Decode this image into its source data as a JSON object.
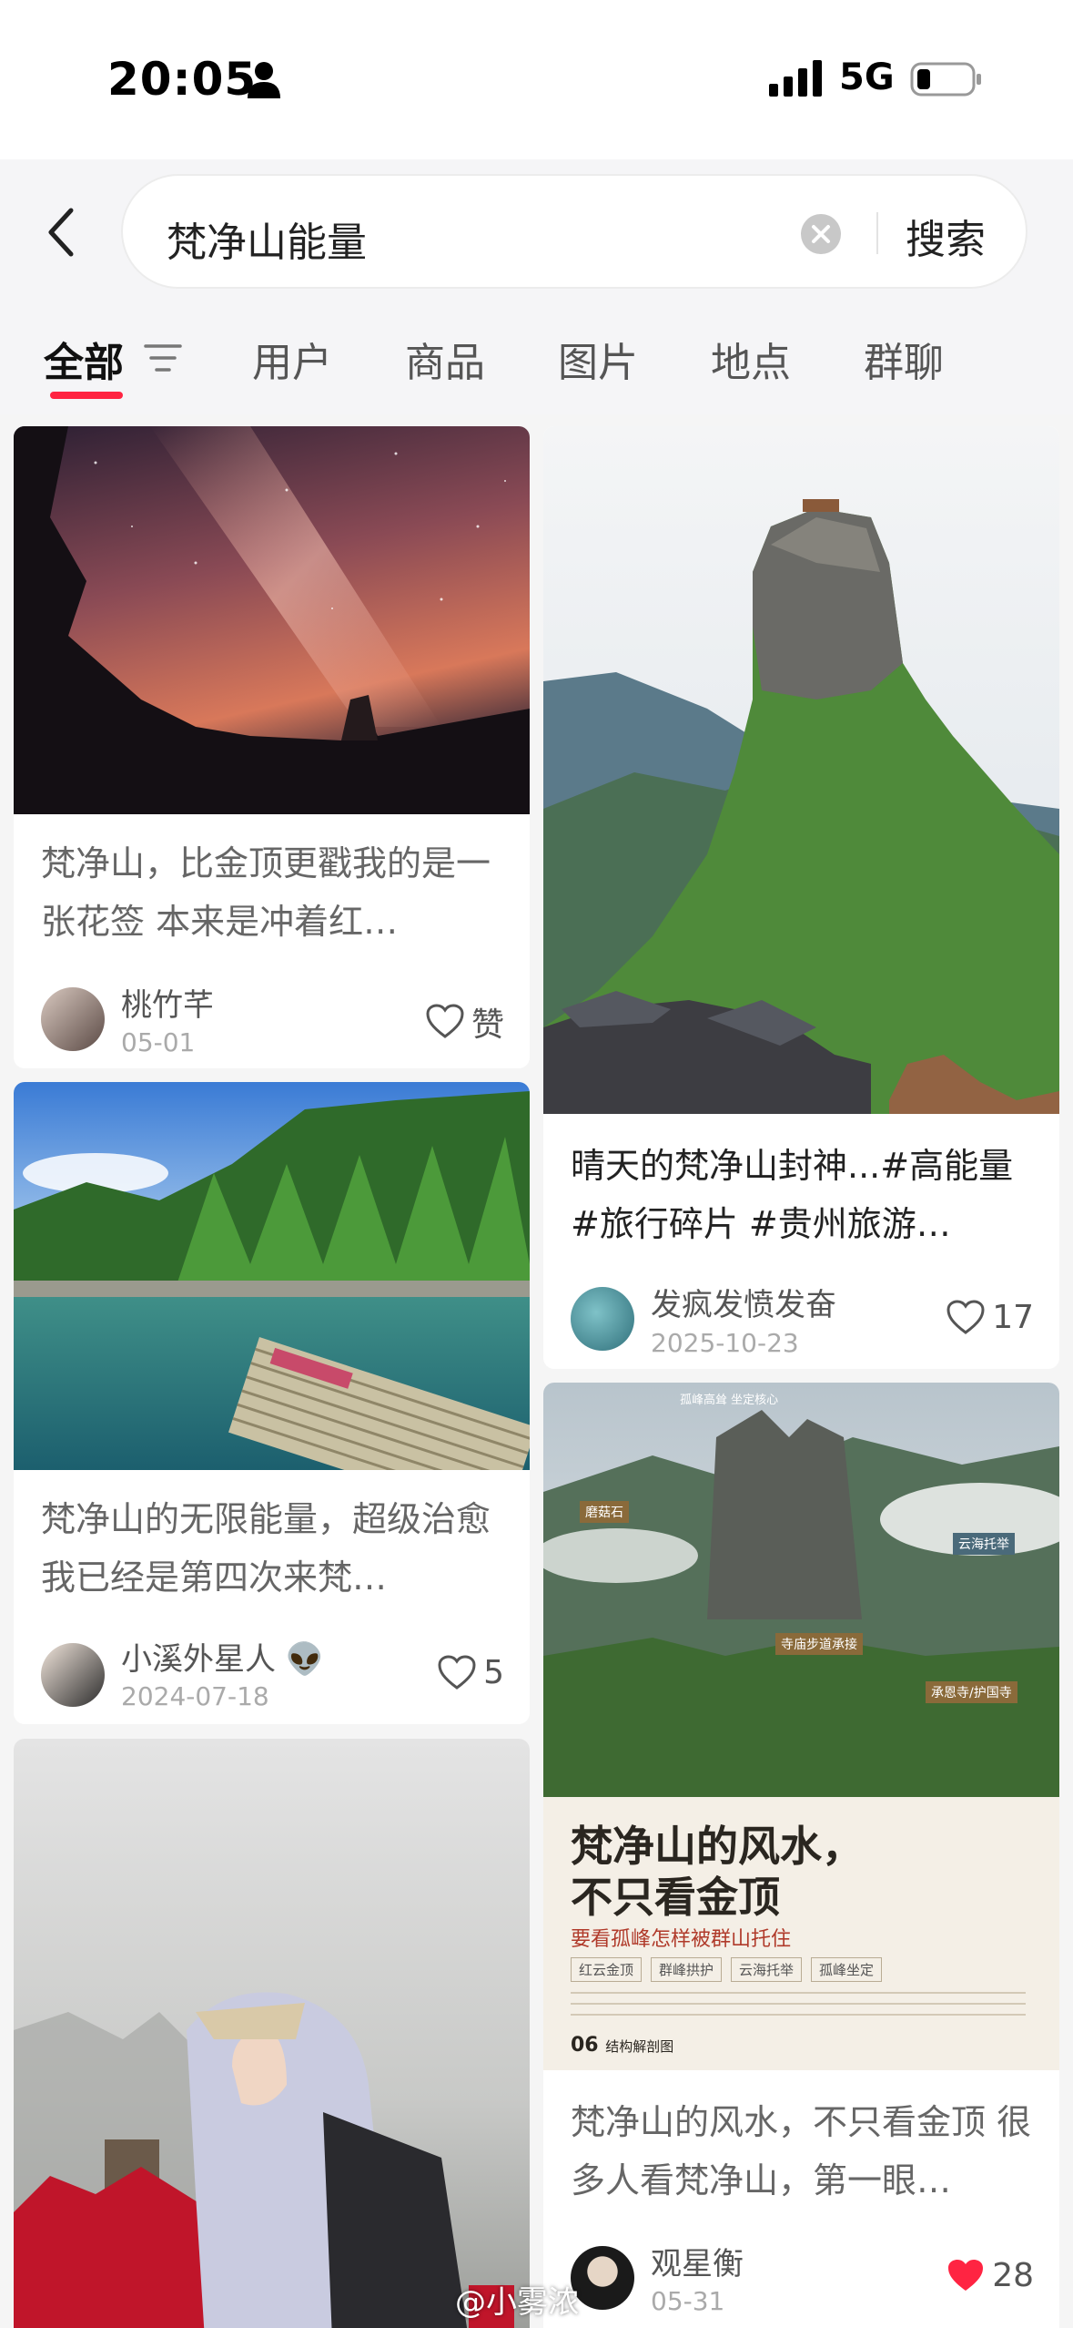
{
  "status_bar": {
    "time": "20:05",
    "network": "5G"
  },
  "search": {
    "query": "梵净山能量",
    "button_label": "搜索"
  },
  "tabs": [
    {
      "label": "全部",
      "active": true
    },
    {
      "label": "用户"
    },
    {
      "label": "商品"
    },
    {
      "label": "图片"
    },
    {
      "label": "地点"
    },
    {
      "label": "群聊"
    }
  ],
  "accent_color": "#ff2442",
  "feed": {
    "left": [
      {
        "title": "梵净山，比金顶更戳我的是一张花签 本来是冲着红…",
        "author": "桃竹芊",
        "date": "05-01",
        "likes": "赞"
      },
      {
        "title": "梵净山的无限能量，超级治愈 我已经是第四次来梵…",
        "author": "小溪外星人 👽",
        "date": "2024-07-18",
        "likes": "5"
      },
      {
        "title": ""
      }
    ],
    "right": [
      {
        "title": "晴天的梵净山封神...#高能量 #旅行碎片 #贵州旅游…",
        "author": "发疯发愤发奋",
        "date": "2025-10-23",
        "likes": "17"
      },
      {
        "title": "梵净山的风水，不只看金顶 很多人看梵净山，第一眼…",
        "author": "观星衡",
        "date": "05-31",
        "likes": "28",
        "liked": true,
        "poster": {
          "headline_1": "梵净山的风水，",
          "headline_2": "不只看金顶",
          "subtitle": "要看孤峰怎样被群山托住",
          "tags": [
            "红云金顶",
            "群峰拱护",
            "云海托举",
            "孤峰坐定"
          ],
          "map_labels": [
            "孤峰高耸 坐定核心",
            "磨菇石",
            "云海托举",
            "寺庙步道承接",
            "承恩寺/护国寺"
          ],
          "section": "06",
          "section_label": "结构解剖图"
        }
      }
    ]
  },
  "watermark": "@小雾浓"
}
